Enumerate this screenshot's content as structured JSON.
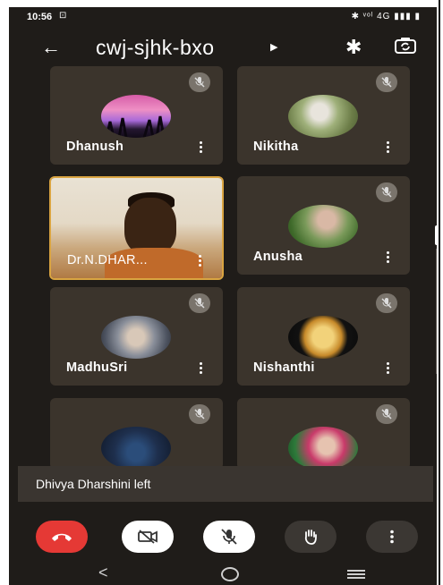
{
  "status_bar": {
    "time": "10:56",
    "cast": "⊡",
    "indicators": "✱ ᵛᵒˡ 4G ▮▮▮ ▮"
  },
  "app_bar": {
    "back": "←",
    "meeting_code": "cwj-sjhk-bxo",
    "caret": "▶",
    "bluetooth": "✱",
    "icons": [
      "back-arrow-icon",
      "bluetooth-icon",
      "switch-camera-icon"
    ]
  },
  "participants": [
    {
      "name": "Dhanush",
      "muted": true
    },
    {
      "name": "Nikitha",
      "muted": true
    },
    {
      "name": "Dr.N.DHAR...",
      "muted": false,
      "video": true
    },
    {
      "name": "Anusha",
      "muted": true
    },
    {
      "name": "MadhuSri",
      "muted": true
    },
    {
      "name": "Nishanthi",
      "muted": true
    },
    {
      "name": "",
      "muted": true
    },
    {
      "name": "",
      "muted": true
    }
  ],
  "toast": {
    "text": "Dhivya Dharshini left"
  },
  "controls": [
    "end-call",
    "camera-off",
    "mic-off",
    "raise-hand",
    "more-options"
  ],
  "nav": {
    "back": "<"
  },
  "colors": {
    "background": "#1f1c19",
    "tile": "#3b342c",
    "end_call": "#e53935",
    "active_border": "#d9a441"
  }
}
